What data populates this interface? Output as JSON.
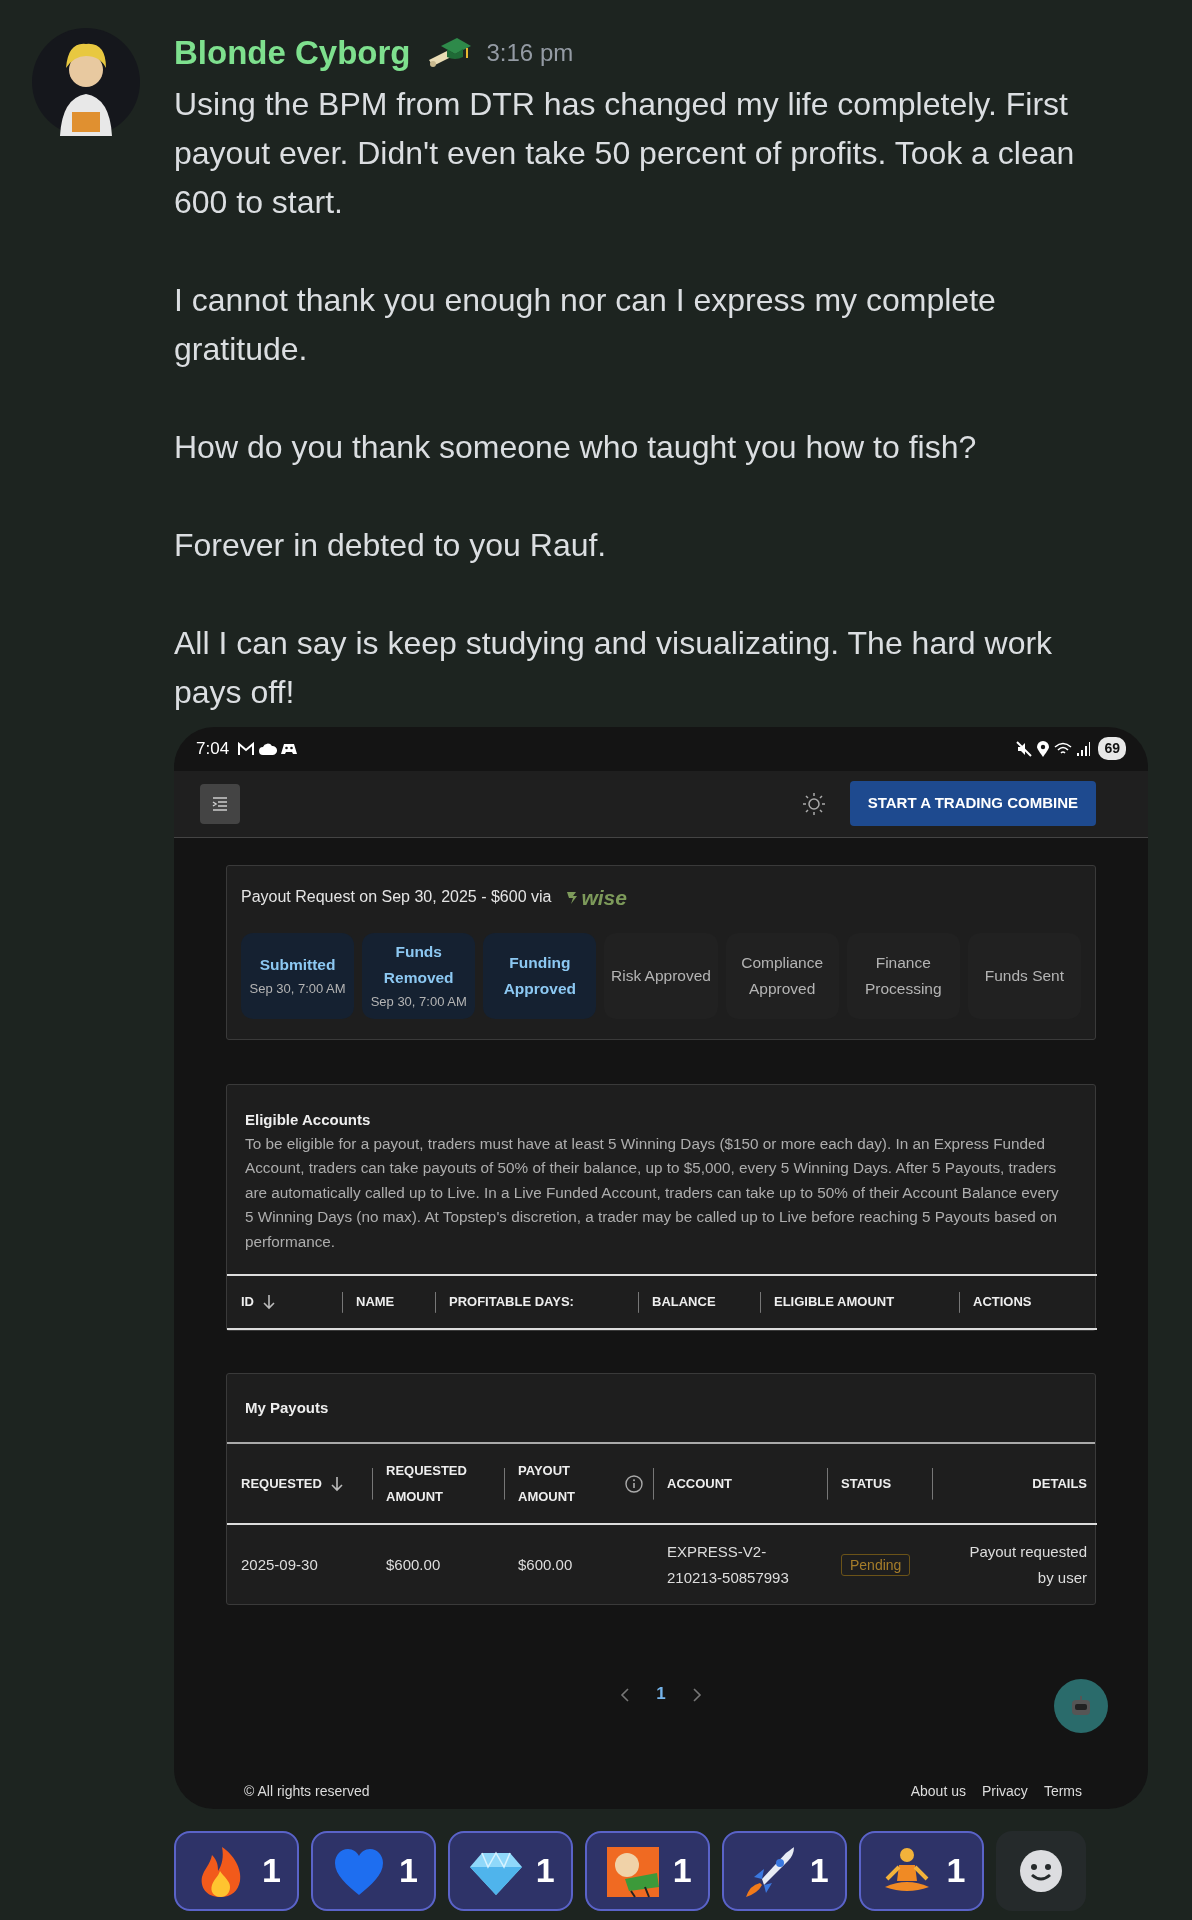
{
  "message": {
    "author": "Blonde Cyborg",
    "timestamp": "3:16 pm",
    "paragraphs": [
      "Using the BPM from DTR has changed my life completely. First payout ever. Didn't even take 50 percent of profits. Took a clean 600 to start.",
      "I cannot thank you enough nor can I express my complete gratitude.",
      "How do you thank someone who taught you how to fish?",
      "Forever in debted to you Rauf.",
      "All I can say is keep studying and visualizating. The hard work pays off!"
    ]
  },
  "embed": {
    "status_bar": {
      "time": "7:04",
      "battery": "69"
    },
    "navbar": {
      "button": "START A TRADING COMBINE"
    },
    "payout_request": {
      "title": "Payout Request on Sep 30, 2025 - $600 via",
      "provider": "wise",
      "steps": [
        {
          "label": "Submitted",
          "date": "Sep 30, 7:00 AM",
          "done": true
        },
        {
          "label": "Funds Removed",
          "date": "Sep 30, 7:00 AM",
          "done": true
        },
        {
          "label": "Funding Approved",
          "done": true
        },
        {
          "label": "Risk Approved",
          "done": false
        },
        {
          "label": "Compliance Approved",
          "done": false
        },
        {
          "label": "Finance Processing",
          "done": false
        },
        {
          "label": "Funds Sent",
          "done": false
        }
      ]
    },
    "eligible_accounts": {
      "title": "Eligible Accounts",
      "description": "To be eligible for a payout, traders must have at least 5 Winning Days ($150 or more each day). In an Express Funded Account, traders can take payouts of 50% of their balance, up to $5,000, every 5 Winning Days. After 5 Payouts, traders are automatically called up to Live. In a Live Funded Account, traders can take up to 50% of their Account Balance every 5 Winning Days (no max). At Topstep's discretion, a trader may be called up to Live before reaching 5 Payouts based on performance.",
      "columns": [
        {
          "label": "ID",
          "sorted": true
        },
        {
          "label": "NAME",
          "sorted": false
        },
        {
          "label": "PROFITABLE DAYS:",
          "sorted": false
        },
        {
          "label": "BALANCE",
          "sorted": false
        },
        {
          "label": "ELIGIBLE AMOUNT",
          "sorted": false
        },
        {
          "label": "ACTIONS",
          "sorted": false
        }
      ]
    },
    "my_payouts": {
      "title": "My Payouts",
      "columns": [
        {
          "label": "REQUESTED",
          "sorted": true,
          "info": false
        },
        {
          "label": "REQUESTED AMOUNT",
          "sorted": false,
          "info": false
        },
        {
          "label": "PAYOUT AMOUNT",
          "sorted": false,
          "info": true
        },
        {
          "label": "ACCOUNT",
          "sorted": false,
          "info": false
        },
        {
          "label": "STATUS",
          "sorted": false,
          "info": false
        },
        {
          "label": "DETAILS",
          "sorted": false,
          "info": false
        }
      ],
      "rows": [
        {
          "requested": "2025-09-30",
          "requested_amount": "$600.00",
          "payout_amount": "$600.00",
          "account": "EXPRESS-V2-210213-50857993",
          "status": "Pending",
          "details": "Payout requested by user"
        }
      ]
    },
    "pagination": {
      "pages": [
        {
          "label": "1",
          "selected": true
        }
      ]
    },
    "footer": {
      "copyright": "© All rights reserved",
      "links": [
        "About us",
        "Privacy",
        "Terms"
      ]
    }
  },
  "reactions": [
    {
      "kind": "fire",
      "count": "1",
      "selected": true
    },
    {
      "kind": "heart",
      "count": "1",
      "selected": true
    },
    {
      "kind": "diamond",
      "count": "1",
      "selected": true
    },
    {
      "kind": "custom",
      "count": "1",
      "selected": true
    },
    {
      "kind": "rocket",
      "count": "1",
      "selected": true
    },
    {
      "kind": "meditate",
      "count": "1",
      "selected": true
    }
  ]
}
